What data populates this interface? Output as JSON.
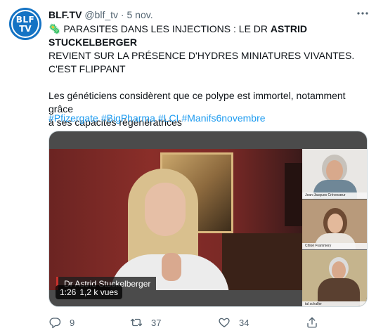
{
  "account": {
    "avatar_text_top": "BLF",
    "avatar_text_bottom": "TV",
    "display_name": "BLF.TV",
    "handle": "@blf_tv",
    "separator": "·",
    "time": "5 nov."
  },
  "tweet": {
    "line1_emoji": "🦠",
    "line1_prefix": "PARASITES DANS LES INJECTIONS : LE DR ",
    "line1_bold": "ASTRID STUCKELBERGER",
    "line2": "REVIENT SUR LA PRÉSENCE D'HYDRES MINIATURES VIVANTES.",
    "line3": "C'EST FLIPPANT",
    "para2_line1": "Les généticiens considèrent que ce polype est immortel, notamment grâce",
    "para2_line2": "à ses capacités régénératrices",
    "hashtags": [
      "#Pfizergate",
      "#BigPharma",
      "#LCI",
      "#Manifs6novembre"
    ]
  },
  "video": {
    "main_caption": "Dr Astrid Stuckelberger",
    "participants": [
      "Jean-Jacques Crèvecœur",
      "Chloé Frammery",
      "tal schaller"
    ],
    "duration": "1:26",
    "views": "1,2 k vues"
  },
  "actions": {
    "replies": "9",
    "retweets": "37",
    "likes": "34"
  },
  "icons": {
    "more": "more-icon",
    "reply": "reply-icon",
    "retweet": "retweet-icon",
    "like": "heart-icon",
    "share": "share-icon"
  },
  "colors": {
    "link": "#1d9bf0",
    "secondary_text": "#536471",
    "avatar_bg": "#1473c4"
  }
}
